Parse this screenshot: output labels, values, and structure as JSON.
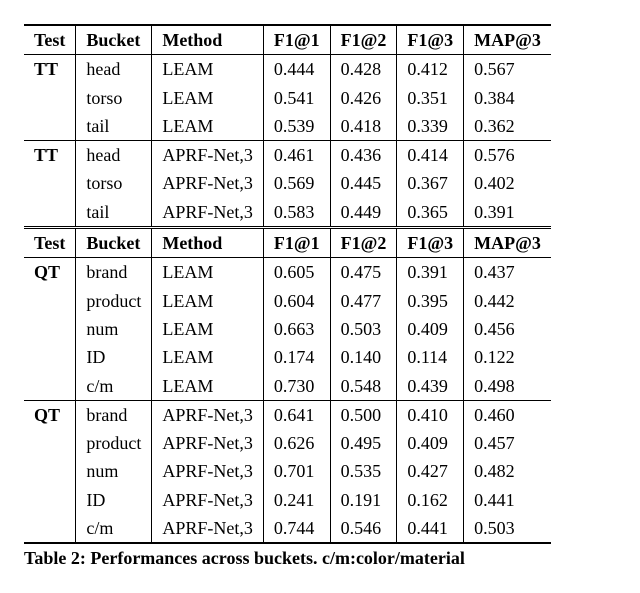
{
  "headers": {
    "test": "Test",
    "bucket": "Bucket",
    "method": "Method",
    "f1_1": "F1@1",
    "f1_2": "F1@2",
    "f1_3": "F1@3",
    "map3": "MAP@3"
  },
  "section1": {
    "group1": {
      "test": "TT",
      "rows": [
        {
          "bucket": "head",
          "method": "LEAM",
          "f1_1": "0.444",
          "f1_2": "0.428",
          "f1_3": "0.412",
          "map3": "0.567"
        },
        {
          "bucket": "torso",
          "method": "LEAM",
          "f1_1": "0.541",
          "f1_2": "0.426",
          "f1_3": "0.351",
          "map3": "0.384"
        },
        {
          "bucket": "tail",
          "method": "LEAM",
          "f1_1": "0.539",
          "f1_2": "0.418",
          "f1_3": "0.339",
          "map3": "0.362"
        }
      ]
    },
    "group2": {
      "test": "TT",
      "rows": [
        {
          "bucket": "head",
          "method": "APRF-Net,3",
          "f1_1": "0.461",
          "f1_2": "0.436",
          "f1_3": "0.414",
          "map3": "0.576"
        },
        {
          "bucket": "torso",
          "method": "APRF-Net,3",
          "f1_1": "0.569",
          "f1_2": "0.445",
          "f1_3": "0.367",
          "map3": "0.402"
        },
        {
          "bucket": "tail",
          "method": "APRF-Net,3",
          "f1_1": "0.583",
          "f1_2": "0.449",
          "f1_3": "0.365",
          "map3": "0.391"
        }
      ]
    }
  },
  "section2": {
    "group1": {
      "test": "QT",
      "rows": [
        {
          "bucket": "brand",
          "method": "LEAM",
          "f1_1": "0.605",
          "f1_2": "0.475",
          "f1_3": "0.391",
          "map3": "0.437"
        },
        {
          "bucket": "product",
          "method": "LEAM",
          "f1_1": "0.604",
          "f1_2": "0.477",
          "f1_3": "0.395",
          "map3": "0.442"
        },
        {
          "bucket": "num",
          "method": "LEAM",
          "f1_1": "0.663",
          "f1_2": "0.503",
          "f1_3": "0.409",
          "map3": "0.456"
        },
        {
          "bucket": "ID",
          "method": "LEAM",
          "f1_1": "0.174",
          "f1_2": "0.140",
          "f1_3": "0.114",
          "map3": "0.122"
        },
        {
          "bucket": "c/m",
          "method": "LEAM",
          "f1_1": "0.730",
          "f1_2": "0.548",
          "f1_3": "0.439",
          "map3": "0.498"
        }
      ]
    },
    "group2": {
      "test": "QT",
      "rows": [
        {
          "bucket": "brand",
          "method": "APRF-Net,3",
          "f1_1": "0.641",
          "f1_2": "0.500",
          "f1_3": "0.410",
          "map3": "0.460"
        },
        {
          "bucket": "product",
          "method": "APRF-Net,3",
          "f1_1": "0.626",
          "f1_2": "0.495",
          "f1_3": "0.409",
          "map3": "0.457"
        },
        {
          "bucket": "num",
          "method": "APRF-Net,3",
          "f1_1": "0.701",
          "f1_2": "0.535",
          "f1_3": "0.427",
          "map3": "0.482"
        },
        {
          "bucket": "ID",
          "method": "APRF-Net,3",
          "f1_1": "0.241",
          "f1_2": "0.191",
          "f1_3": "0.162",
          "map3": "0.441"
        },
        {
          "bucket": "c/m",
          "method": "APRF-Net,3",
          "f1_1": "0.744",
          "f1_2": "0.546",
          "f1_3": "0.441",
          "map3": "0.503"
        }
      ]
    }
  },
  "caption": "Table 2: Performances across buckets. c/m:color/material",
  "chart_data": {
    "type": "table",
    "title": "Table 2: Performances across buckets. c/m:color/material",
    "columns": [
      "Test",
      "Bucket",
      "Method",
      "F1@1",
      "F1@2",
      "F1@3",
      "MAP@3"
    ],
    "rows": [
      [
        "TT",
        "head",
        "LEAM",
        0.444,
        0.428,
        0.412,
        0.567
      ],
      [
        "TT",
        "torso",
        "LEAM",
        0.541,
        0.426,
        0.351,
        0.384
      ],
      [
        "TT",
        "tail",
        "LEAM",
        0.539,
        0.418,
        0.339,
        0.362
      ],
      [
        "TT",
        "head",
        "APRF-Net,3",
        0.461,
        0.436,
        0.414,
        0.576
      ],
      [
        "TT",
        "torso",
        "APRF-Net,3",
        0.569,
        0.445,
        0.367,
        0.402
      ],
      [
        "TT",
        "tail",
        "APRF-Net,3",
        0.583,
        0.449,
        0.365,
        0.391
      ],
      [
        "QT",
        "brand",
        "LEAM",
        0.605,
        0.475,
        0.391,
        0.437
      ],
      [
        "QT",
        "product",
        "LEAM",
        0.604,
        0.477,
        0.395,
        0.442
      ],
      [
        "QT",
        "num",
        "LEAM",
        0.663,
        0.503,
        0.409,
        0.456
      ],
      [
        "QT",
        "ID",
        "LEAM",
        0.174,
        0.14,
        0.114,
        0.122
      ],
      [
        "QT",
        "c/m",
        "LEAM",
        0.73,
        0.548,
        0.439,
        0.498
      ],
      [
        "QT",
        "brand",
        "APRF-Net,3",
        0.641,
        0.5,
        0.41,
        0.46
      ],
      [
        "QT",
        "product",
        "APRF-Net,3",
        0.626,
        0.495,
        0.409,
        0.457
      ],
      [
        "QT",
        "num",
        "APRF-Net,3",
        0.701,
        0.535,
        0.427,
        0.482
      ],
      [
        "QT",
        "ID",
        "APRF-Net,3",
        0.241,
        0.191,
        0.162,
        0.441
      ],
      [
        "QT",
        "c/m",
        "APRF-Net,3",
        0.744,
        0.546,
        0.441,
        0.503
      ]
    ]
  }
}
